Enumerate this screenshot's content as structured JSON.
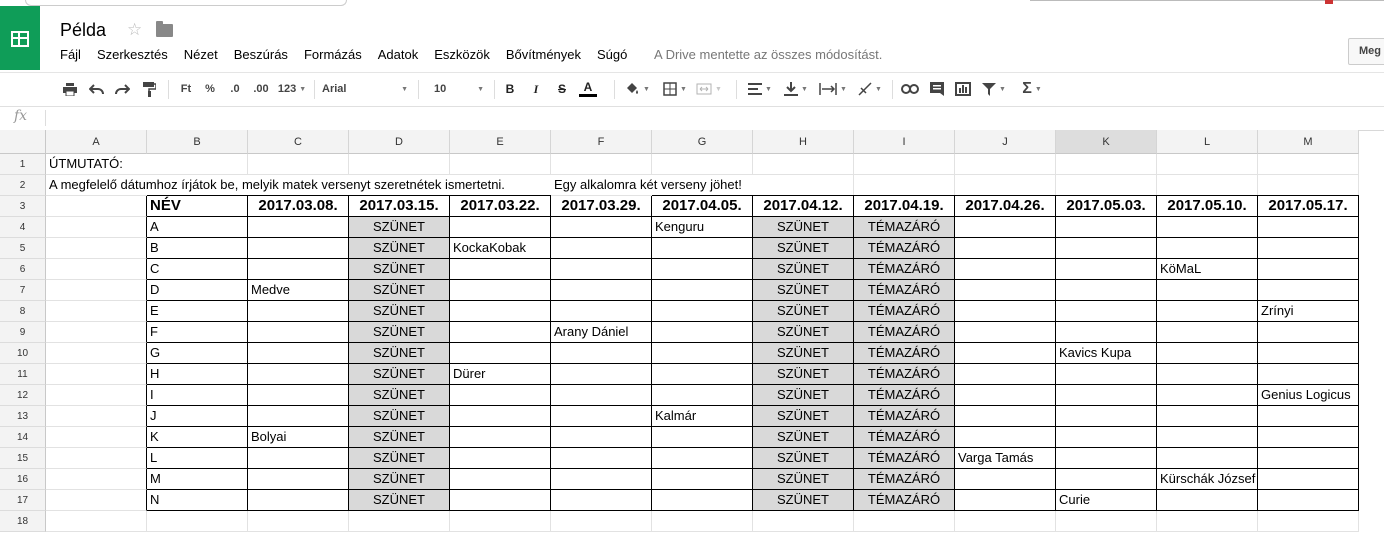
{
  "app": {
    "doc_title": "Példa",
    "menu": [
      "Fájl",
      "Szerkesztés",
      "Nézet",
      "Beszúrás",
      "Formázás",
      "Adatok",
      "Eszközök",
      "Bővítmények",
      "Súgó"
    ],
    "save_status": "A Drive mentette az összes módosítást.",
    "share_button": "Meg"
  },
  "toolbar": {
    "currency": "Ft",
    "percent": "%",
    "dec_decrease": ".0",
    "dec_increase": ".00",
    "more_formats": "123",
    "font": "Arial",
    "font_size": "10",
    "bold": "B",
    "italic": "I",
    "strike": "S",
    "text_color_letter": "A",
    "accent_color": "#0f9d58"
  },
  "formula_bar": {
    "fx": "fx",
    "value": ""
  },
  "sheet": {
    "columns": [
      "A",
      "B",
      "C",
      "D",
      "E",
      "F",
      "G",
      "H",
      "I",
      "J",
      "K",
      "L",
      "M"
    ],
    "rows": [
      "1",
      "2",
      "3",
      "4",
      "5",
      "6",
      "7",
      "8",
      "9",
      "10",
      "11",
      "12",
      "13",
      "14",
      "15",
      "16",
      "17",
      "18"
    ],
    "r1": "ÚTMUTATÓ:",
    "r2_a": "A megfelelő dátumhoz írjátok be, melyik matek versenyt szeretnétek ismertetni.",
    "r2_f": "Egy alkalomra két verseny jöhet!",
    "header": [
      "NÉV",
      "2017.03.08.",
      "2017.03.15.",
      "2017.03.22.",
      "2017.03.29.",
      "2017.04.05.",
      "2017.04.12.",
      "2017.04.19.",
      "2017.04.26.",
      "2017.05.03.",
      "2017.05.10.",
      "2017.05.17."
    ],
    "table": [
      [
        "A",
        "",
        "SZÜNET",
        "",
        "",
        "Kenguru",
        "SZÜNET",
        "TÉMAZÁRÓ",
        "",
        "",
        "",
        ""
      ],
      [
        "B",
        "",
        "SZÜNET",
        "KockaKobak",
        "",
        "",
        "SZÜNET",
        "TÉMAZÁRÓ",
        "",
        "",
        "",
        ""
      ],
      [
        "C",
        "",
        "SZÜNET",
        "",
        "",
        "",
        "SZÜNET",
        "TÉMAZÁRÓ",
        "",
        "",
        "KöMaL",
        ""
      ],
      [
        "D",
        "Medve",
        "SZÜNET",
        "",
        "",
        "",
        "SZÜNET",
        "TÉMAZÁRÓ",
        "",
        "",
        "",
        ""
      ],
      [
        "E",
        "",
        "SZÜNET",
        "",
        "",
        "",
        "SZÜNET",
        "TÉMAZÁRÓ",
        "",
        "",
        "",
        "Zrínyi"
      ],
      [
        "F",
        "",
        "SZÜNET",
        "",
        "Arany Dániel",
        "",
        "SZÜNET",
        "TÉMAZÁRÓ",
        "",
        "",
        "",
        ""
      ],
      [
        "G",
        "",
        "SZÜNET",
        "",
        "",
        "",
        "SZÜNET",
        "TÉMAZÁRÓ",
        "",
        "Kavics Kupa",
        "",
        ""
      ],
      [
        "H",
        "",
        "SZÜNET",
        "Dürer",
        "",
        "",
        "SZÜNET",
        "TÉMAZÁRÓ",
        "",
        "",
        "",
        ""
      ],
      [
        "I",
        "",
        "SZÜNET",
        "",
        "",
        "",
        "SZÜNET",
        "TÉMAZÁRÓ",
        "",
        "",
        "",
        "Genius Logicus"
      ],
      [
        "J",
        "",
        "SZÜNET",
        "",
        "",
        "Kalmár",
        "SZÜNET",
        "TÉMAZÁRÓ",
        "",
        "",
        "",
        ""
      ],
      [
        "K",
        "Bolyai",
        "SZÜNET",
        "",
        "",
        "",
        "SZÜNET",
        "TÉMAZÁRÓ",
        "",
        "",
        "",
        ""
      ],
      [
        "L",
        "",
        "SZÜNET",
        "",
        "",
        "",
        "SZÜNET",
        "TÉMAZÁRÓ",
        "Varga Tamás",
        "",
        "",
        ""
      ],
      [
        "M",
        "",
        "SZÜNET",
        "",
        "",
        "",
        "SZÜNET",
        "TÉMAZÁRÓ",
        "",
        "",
        "Kürschák József",
        ""
      ],
      [
        "N",
        "",
        "SZÜNET",
        "",
        "",
        "",
        "SZÜNET",
        "TÉMAZÁRÓ",
        "",
        "Curie",
        "",
        ""
      ]
    ],
    "selected_column": "K",
    "gray_fill": "#d9d9d9"
  }
}
